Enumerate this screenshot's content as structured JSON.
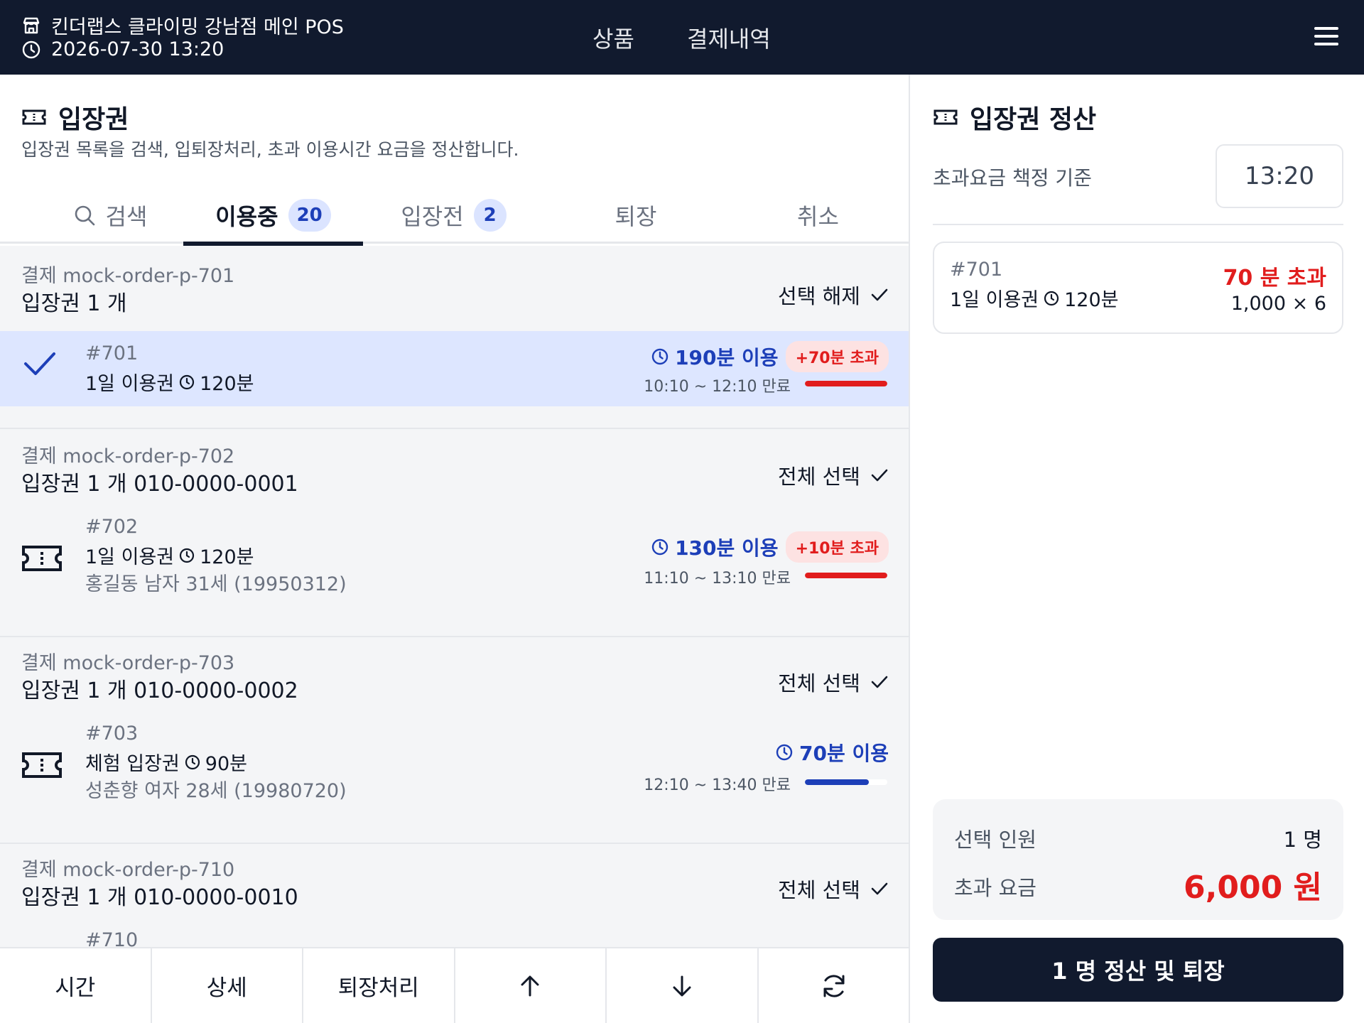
{
  "header": {
    "store_name": "킨더랩스 클라이밍 강남점 메인 POS",
    "datetime": "2026-07-30 13:20",
    "nav": [
      "상품",
      "결제내역"
    ]
  },
  "page": {
    "title": "입장권",
    "subtitle": "입장권 목록을 검색, 입퇴장처리, 초과 이용시간 요금을 정산합니다."
  },
  "tabs": [
    {
      "label": "검색",
      "count": ""
    },
    {
      "label": "이용중",
      "count": "20"
    },
    {
      "label": "입장전",
      "count": "2"
    },
    {
      "label": "퇴장",
      "count": ""
    },
    {
      "label": "취소",
      "count": ""
    }
  ],
  "groups": [
    {
      "payment": "결제 mock-order-p-701",
      "summary": "입장권 1 개",
      "select_label": "선택 해제",
      "ticket": {
        "number": "#701",
        "product": "1일 이용권",
        "duration": "120분",
        "owner": "",
        "usage": "190분 이용",
        "overtime": "+70분 초과",
        "range": "10:10 ~ 12:10 만료",
        "progress": 1.0,
        "status_color": "#e11d1d"
      }
    },
    {
      "payment": "결제 mock-order-p-702",
      "summary": "입장권 1 개 010-0000-0001",
      "select_label": "전체 선택",
      "ticket": {
        "number": "#702",
        "product": "1일 이용권",
        "duration": "120분",
        "owner": "홍길동 남자 31세 (19950312)",
        "usage": "130분 이용",
        "overtime": "+10분 초과",
        "range": "11:10 ~ 13:10 만료",
        "progress": 1.0,
        "status_color": "#e11d1d"
      }
    },
    {
      "payment": "결제 mock-order-p-703",
      "summary": "입장권 1 개 010-0000-0002",
      "select_label": "전체 선택",
      "ticket": {
        "number": "#703",
        "product": "체험 입장권",
        "duration": "90분",
        "owner": "성춘향 여자 28세 (19980720)",
        "usage": "70분 이용",
        "overtime": "",
        "range": "12:10 ~ 13:40 만료",
        "progress": 0.78,
        "status_color": "#1d3fb8"
      }
    },
    {
      "payment": "결제 mock-order-p-710",
      "summary": "입장권 1 개 010-0000-0010",
      "select_label": "전체 선택",
      "ticket": {
        "number": "#710",
        "product": "",
        "duration": "",
        "owner": "",
        "usage": "",
        "overtime": "",
        "range": "",
        "progress": 0,
        "status_color": "#1d3fb8"
      }
    }
  ],
  "toolbar": {
    "time": "시간",
    "detail": "상세",
    "checkout": "퇴장처리"
  },
  "settlement": {
    "title": "입장권 정산",
    "basis_label": "초과요금 책정 기준",
    "basis_time": "13:20",
    "item": {
      "number": "#701",
      "product": "1일 이용권",
      "duration": "120분",
      "overtime": "70 분 초과",
      "calc": "1,000 × 6"
    },
    "people_label": "선택 인원",
    "people_value": "1 명",
    "fee_label": "초과 요금",
    "fee_value": "6,000 원",
    "cta": "1 명 정산 및 퇴장"
  },
  "colors": {
    "brand": "#111a2e",
    "accent": "#1d3fb8",
    "over": "#e11d1d",
    "selected_row": "#dde6ff"
  }
}
